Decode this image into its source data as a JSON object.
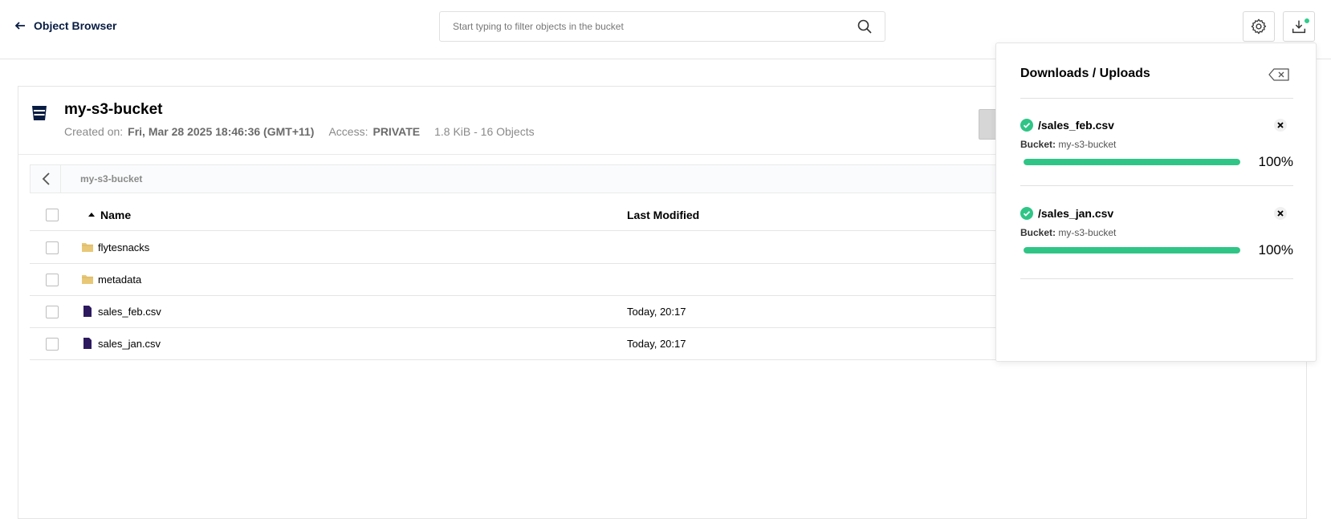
{
  "header": {
    "back_label": "Object Browser",
    "search_placeholder": "Start typing to filter objects in the bucket",
    "settings_icon": "gear-icon",
    "downloads_icon": "download-icon"
  },
  "bucket": {
    "name": "my-s3-bucket",
    "created_label": "Created on:",
    "created_value": "Fri, Mar 28 2025 18:46:36 (GMT+11)",
    "access_label": "Access:",
    "access_value": "PRIVATE",
    "size_summary": "1.8 KiB - 16 Objects"
  },
  "breadcrumb": {
    "path": "my-s3-bucket"
  },
  "table": {
    "columns": {
      "name": "Name",
      "last_modified": "Last Modified"
    },
    "rows": [
      {
        "type": "folder",
        "name": "flytesnacks",
        "modified": ""
      },
      {
        "type": "folder",
        "name": "metadata",
        "modified": ""
      },
      {
        "type": "file",
        "name": "sales_feb.csv",
        "modified": "Today, 20:17"
      },
      {
        "type": "file",
        "name": "sales_jan.csv",
        "modified": "Today, 20:17"
      }
    ]
  },
  "panel": {
    "title": "Downloads / Uploads",
    "items": [
      {
        "name": "/sales_feb.csv",
        "bucket_label": "Bucket:",
        "bucket_value": "my-s3-bucket",
        "progress": 100,
        "progress_text": "100%"
      },
      {
        "name": "/sales_jan.csv",
        "bucket_label": "Bucket:",
        "bucket_value": "my-s3-bucket",
        "progress": 100,
        "progress_text": "100%"
      }
    ]
  },
  "colors": {
    "accent_green": "#2fc586",
    "folder": "#e8c877",
    "file": "#2d1a5e",
    "navy": "#081c42"
  }
}
